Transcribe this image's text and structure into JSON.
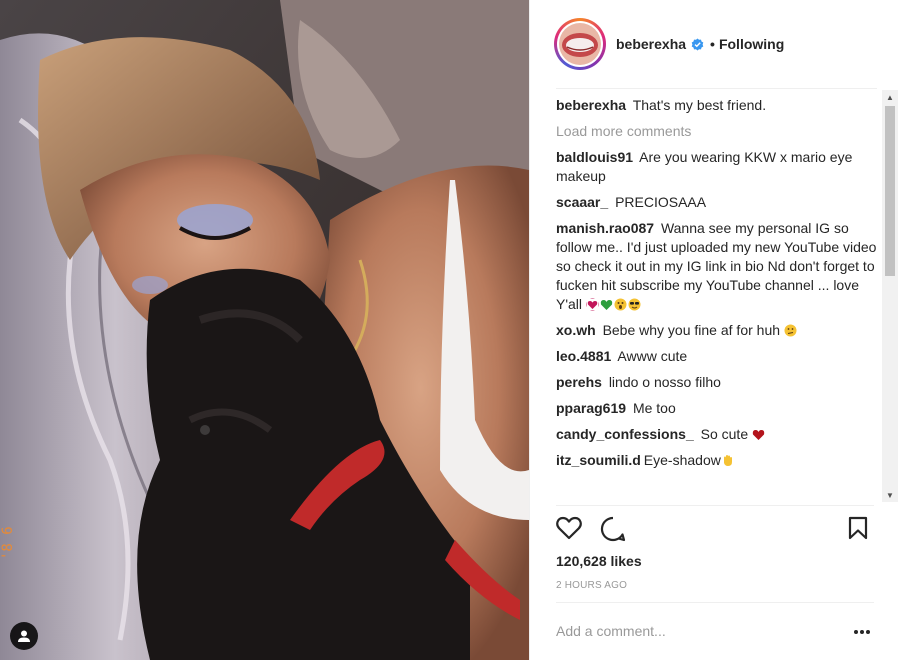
{
  "post": {
    "username": "beberexha",
    "separator": "•",
    "follow_status": "Following",
    "likes": "120,628 likes",
    "time": "2 HOURS AGO",
    "photo_date_stamp": "'8 6"
  },
  "icons": {
    "verified": "verified-badge-icon",
    "like": "heart-icon",
    "comment": "comment-icon",
    "save": "bookmark-icon",
    "more": "more-options-icon",
    "tag": "user-tag-icon"
  },
  "comments": {
    "caption": {
      "user": "beberexha",
      "text": "That's my best friend."
    },
    "load_more": "Load more comments",
    "items": [
      {
        "user": "baldlouis91",
        "text": "Are you wearing KKW x mario eye makeup"
      },
      {
        "user": "scaaar_",
        "text": "PRECIOSAAA"
      },
      {
        "user": "manish.rao087",
        "text": "Wanna see my personal IG so follow me.. I'd just uploaded my new YouTube video so check it out in my IG link in bio Nd don't forget to fucken hit subscribe my YouTube channel ... love Y'all"
      },
      {
        "user": "xo.wh",
        "text": "Bebe why you fine af for huh"
      },
      {
        "user": "leo.4881",
        "text": "Awww cute"
      },
      {
        "user": "perehs",
        "text": "lindo o nosso filho"
      },
      {
        "user": "pparag619",
        "text": "Me too"
      },
      {
        "user": "candy_confessions_",
        "text": "So cute"
      },
      {
        "user": "itz_soumili.d",
        "text": "Eye-shadow"
      }
    ]
  },
  "add_comment": {
    "placeholder": "Add a comment..."
  },
  "colors": {
    "verified": "#3897f0",
    "muted": "#999999",
    "text": "#262626",
    "heart_emoji": "#c2185b"
  }
}
